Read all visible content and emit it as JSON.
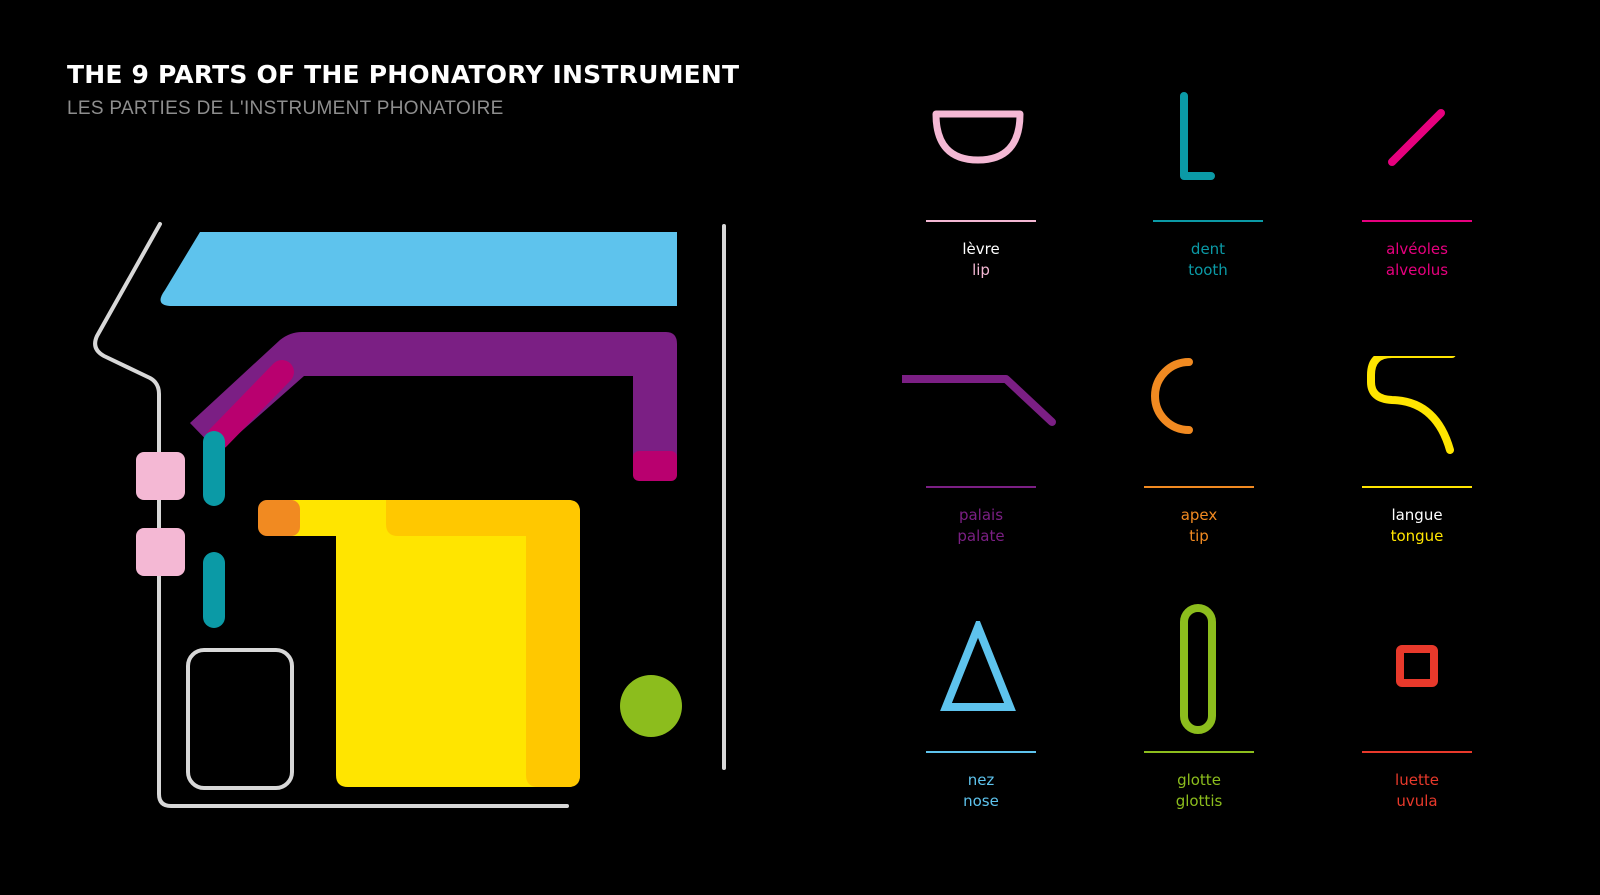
{
  "header": {
    "title": "THE 9 PARTS OF THE PHONATORY INSTRUMENT",
    "subtitle": "LES PARTIES DE L'INSTRUMENT PHONATOIRE"
  },
  "colors": {
    "background": "#000000",
    "outline": "#d8d8d8",
    "lip": "#f4b8d4",
    "tooth": "#0b9aa6",
    "alveolus": "#e6007e",
    "palate": "#7b1f84",
    "tip": "#f18a21",
    "tongue": "#ffe500",
    "tongue_shade": "#ffc800",
    "nose": "#5ec3ed",
    "glottis": "#8cbd1d",
    "uvula": "#e8392b"
  },
  "legend": [
    {
      "id": "lip",
      "fr": "lèvre",
      "en": "lip",
      "icon": "half-disc-icon",
      "color": "#f4b8d4",
      "fr_color": "#ffffff",
      "en_color": "#f4b8d4"
    },
    {
      "id": "tooth",
      "fr": "dent",
      "en": "tooth",
      "icon": "l-shape-icon",
      "color": "#0b9aa6",
      "fr_color": "#0b9aa6",
      "en_color": "#0b9aa6"
    },
    {
      "id": "alveolus",
      "fr": "alvéoles",
      "en": "alveolus",
      "icon": "slash-icon",
      "color": "#e6007e",
      "fr_color": "#e6007e",
      "en_color": "#e6007e"
    },
    {
      "id": "palate",
      "fr": "palais",
      "en": "palate",
      "icon": "bent-line-icon",
      "color": "#7b1f84",
      "fr_color": "#7b1f84",
      "en_color": "#7b1f84"
    },
    {
      "id": "tip",
      "fr": "apex",
      "en": "tip",
      "icon": "arc-icon",
      "color": "#f18a21",
      "fr_color": "#f18a21",
      "en_color": "#f18a21"
    },
    {
      "id": "tongue",
      "fr": "langue",
      "en": "tongue",
      "icon": "s-curve-icon",
      "color": "#ffe500",
      "fr_color": "#ffffff",
      "en_color": "#ffe500"
    },
    {
      "id": "nose",
      "fr": "nez",
      "en": "nose",
      "icon": "triangle-icon",
      "color": "#5ec3ed",
      "fr_color": "#5ec3ed",
      "en_color": "#5ec3ed"
    },
    {
      "id": "glottis",
      "fr": "glotte",
      "en": "glottis",
      "icon": "capsule-icon",
      "color": "#8cbd1d",
      "fr_color": "#8cbd1d",
      "en_color": "#8cbd1d"
    },
    {
      "id": "uvula",
      "fr": "luette",
      "en": "uvula",
      "icon": "square-icon",
      "color": "#e8392b",
      "fr_color": "#e8392b",
      "en_color": "#e8392b"
    }
  ]
}
